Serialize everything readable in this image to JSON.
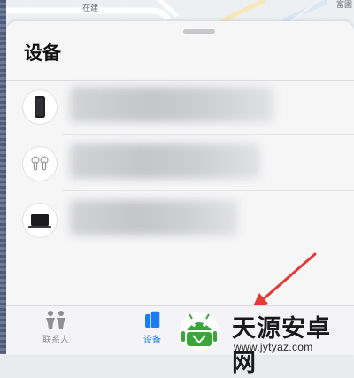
{
  "map": {
    "label_street": "在建",
    "label_corner": "富園"
  },
  "sheet": {
    "title": "设备",
    "devices": [
      {
        "icon": "iphone-icon",
        "name": ""
      },
      {
        "icon": "airpods-icon",
        "name": ""
      },
      {
        "icon": "macbook-icon",
        "name": ""
      }
    ]
  },
  "tabbar": {
    "tabs": [
      {
        "label": "联系人",
        "icon": "people-icon",
        "active": false
      },
      {
        "label": "设备",
        "icon": "devices-icon",
        "active": true
      }
    ]
  },
  "watermark": {
    "title": "天源安卓网",
    "url": "www.jytyaz.com"
  },
  "colors": {
    "accent": "#1a7cf5",
    "arrow": "#e53935",
    "watermark_green": "#3aa63a"
  }
}
